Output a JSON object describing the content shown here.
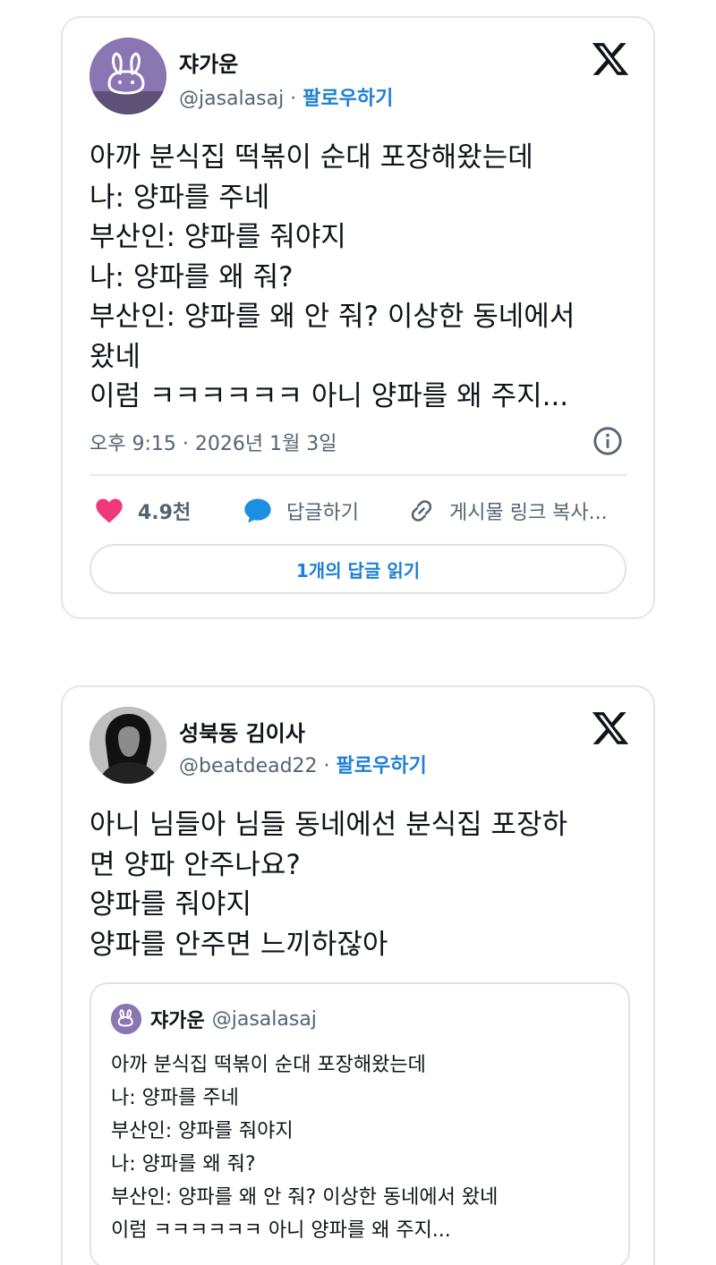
{
  "tweet1": {
    "display_name": "쟈가운",
    "handle": "@jasalasaj",
    "separator": " · ",
    "follow_label": "팔로우하기",
    "lines": [
      "아까 분식집 떡볶이 순대 포장해왔는데",
      "나: 양파를 주네",
      "부산인: 양파를 줘야지",
      "나: 양파를 왜 줘?",
      "부산인: 양파를 왜 안 줘? 이상한 동네에서",
      "왔네",
      "이럼 ㅋㅋㅋㅋㅋㅋ 아니 양파를 왜 주지..."
    ],
    "timestamp": "오후 9:15 · 2026년 1월 3일",
    "like_count": "4.9천",
    "reply_label": "답글하기",
    "copy_link_label": "게시물 링크 복사...",
    "read_replies_label": "1개의 답글 읽기",
    "avatar_color": "#8a76b3"
  },
  "tweet2": {
    "display_name": "성북동 김이사",
    "handle": "@beatdead22",
    "separator": " · ",
    "follow_label": "팔로우하기",
    "lines": [
      "아니 님들아 님들 동네에선 분식집 포장하",
      "면 양파 안주나요?",
      "양파를 줘야지",
      "양파를 안주면 느끼하잖아"
    ],
    "quote": {
      "display_name": "쟈가운",
      "handle": "@jasalasaj",
      "lines": [
        "아까 분식집 떡볶이 순대 포장해왔는데",
        "나: 양파를 주네",
        "부산인: 양파를 줘야지",
        "나: 양파를 왜 줘?",
        "부산인: 양파를 왜 안 줘? 이상한 동네에서 왔네",
        "이럼 ㅋㅋㅋㅋㅋㅋ 아니 양파를 왜 주지..."
      ]
    }
  },
  "colors": {
    "link_blue": "#1d7fd6",
    "heart_pink": "#f2387d",
    "reply_blue": "#1d8fe0",
    "muted_gray": "#536471"
  },
  "icons": [
    "x-logo-icon",
    "info-icon",
    "heart-icon",
    "reply-bubble-icon",
    "link-icon"
  ]
}
